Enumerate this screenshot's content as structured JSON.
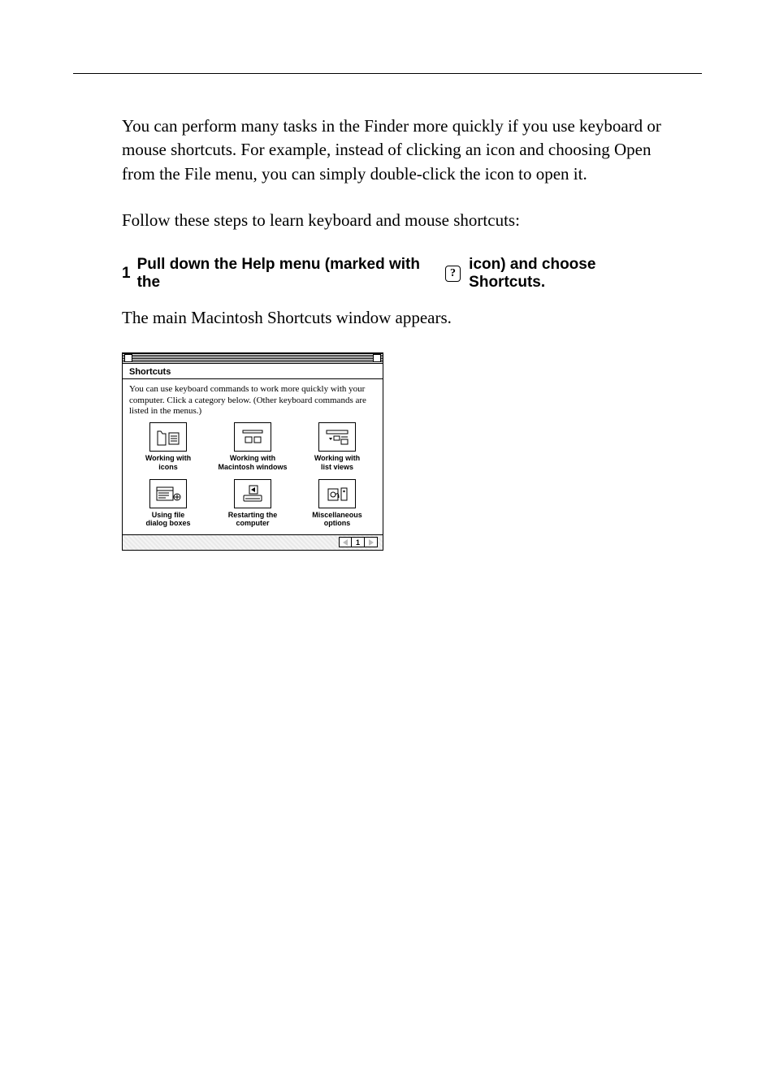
{
  "prose": {
    "p1": "You can perform many tasks in the Finder more quickly if you use keyboard or mouse shortcuts. For example, instead of clicking an icon and choosing Open from the File menu, you can simply double-click the icon to open it.",
    "p2": "Follow these steps to learn keyboard and mouse shortcuts:",
    "caption": "The main Macintosh Shortcuts window appears."
  },
  "step": {
    "num": "1",
    "before": "Pull down the Help menu (marked with the ",
    "badge": "?",
    "after": " icon) and choose Shortcuts."
  },
  "window": {
    "title": "Shortcuts",
    "intro": "You can use keyboard commands to work more quickly with your computer. Click a category below. (Other keyboard commands are listed in the menus.)",
    "items": [
      {
        "label_l1": "Working with",
        "label_l2": "icons",
        "icon": "icons"
      },
      {
        "label_l1": "Working with",
        "label_l2": "Macintosh windows",
        "icon": "windows"
      },
      {
        "label_l1": "Working with",
        "label_l2": "list views",
        "icon": "listviews"
      },
      {
        "label_l1": "Using file",
        "label_l2": "dialog boxes",
        "icon": "dialogs"
      },
      {
        "label_l1": "Restarting the",
        "label_l2": "computer",
        "icon": "restart"
      },
      {
        "label_l1": "Miscellaneous",
        "label_l2": "options",
        "icon": "misc"
      }
    ],
    "pager": {
      "prev": "◀",
      "page": "1",
      "next": "▶"
    }
  }
}
